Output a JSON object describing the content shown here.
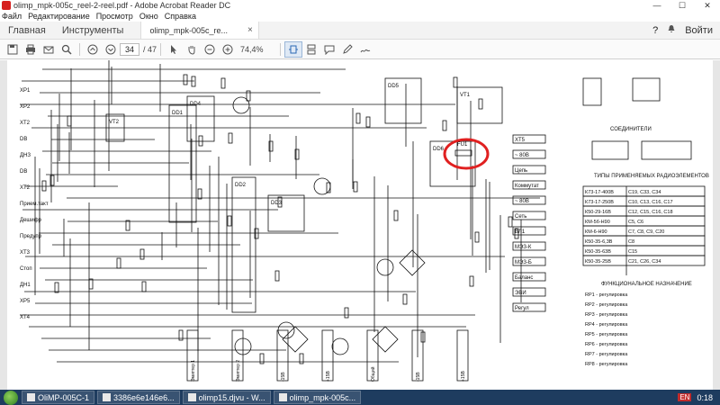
{
  "window": {
    "title": "olimp_mpk-005c_reel-2-reel.pdf - Adobe Acrobat Reader DC",
    "min": "—",
    "max": "☐",
    "close": "✕"
  },
  "menu": [
    "Файл",
    "Редактирование",
    "Просмотр",
    "Окно",
    "Справка"
  ],
  "tabs": {
    "home": "Главная",
    "tools": "Инструменты",
    "doc": "olimp_mpk-005c_re...",
    "doc_close": "×",
    "help": "?",
    "bell": "🔔",
    "signin": "Войти"
  },
  "toolbar": {
    "page_current": "34",
    "page_total": "/ 47",
    "zoom": "74,4%"
  },
  "schematic": {
    "labels_left": [
      "XP1",
      "XP2",
      "XT2",
      "DВ",
      "ДНЗ",
      "DВ",
      "XT2",
      "Прием.такт",
      "Дешифр",
      "Предупр",
      "XT3",
      "Стоп",
      "ДН1",
      "XP5",
      "XT4"
    ],
    "labels_mid": [
      "DD1",
      "DD2",
      "DD3",
      "DD4",
      "DD5",
      "DD6",
      "VT1",
      "VT2",
      "VT3",
      "VT4",
      "VD1",
      "VD2",
      "VT5",
      "VT6",
      "VT7",
      "UZ1",
      "UZ2",
      "UZ3"
    ],
    "labels_right": [
      "XT5",
      "~ 80В",
      "Цепь",
      "Коммутат",
      "~ 80В",
      "Сеть",
      "ВЛ1",
      "МЭЗ-К",
      "МЭЗ-Б",
      "Баланс",
      "ЭВИ",
      "Регул"
    ],
    "fuse_label": "FU1",
    "table_title": "ТИПЫ ПРИМЕНЯЕМЫХ РАДИОЭЛЕМЕНТОВ",
    "table_rows": [
      [
        "К73-17-400В",
        "С19, С33, С34"
      ],
      [
        "К73-17-250В",
        "С10, С13, С16, С17"
      ],
      [
        "К50-29-16В",
        "С12, С15, С16, С18"
      ],
      [
        "КМ-5б-Н90",
        "С5, С6"
      ],
      [
        "КМ-6-Н90",
        "С7, С8, С9, С20"
      ],
      [
        "К50-35-6,3В",
        "С8"
      ],
      [
        "К50-35-63В",
        "С15"
      ],
      [
        "К50-35-25В",
        "С21, С26, С34"
      ]
    ],
    "legend_title": "ФУНКЦИОНАЛЬНОЕ НАЗНАЧЕНИЕ",
    "legend": [
      "RP1 - регулировка",
      "RP2 - регулировка",
      "RP3 - регулировка",
      "RP4 - регулировка",
      "RP5 - регулировка",
      "RP6 - регулировка",
      "RP7 - регулировка",
      "RP8 - регулировка"
    ],
    "connector_title": "СОЕДИНИТЕЛИ",
    "bottom_labels": [
      "Эмиттер 1",
      "Эмиттер 2",
      "-15В",
      "+15В",
      "Общий",
      "-15В",
      "+15В"
    ]
  },
  "taskbar": {
    "items": [
      "OlіMP-005C-1",
      "3386e6e146e6...",
      "olimp15.djvu - W...",
      "olimp_mpk-005c..."
    ],
    "lang": "EN",
    "time": "0:18"
  },
  "colors": {
    "highlight": "#e02020",
    "taskbar": "#1e3c5f"
  }
}
